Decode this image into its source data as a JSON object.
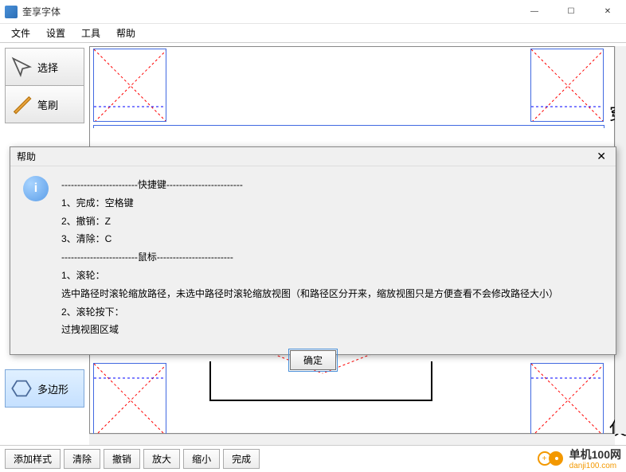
{
  "window": {
    "title": "奎享字体",
    "min": "—",
    "max": "☐",
    "close": "✕"
  },
  "menu": {
    "file": "文件",
    "settings": "设置",
    "tools": "工具",
    "help": "帮助"
  },
  "tools": {
    "select": "选择",
    "brush": "笔刷",
    "polygon": "多边形"
  },
  "chars": {
    "c1": "穿",
    "c2": "仗"
  },
  "bottom": {
    "addStyle": "添加样式",
    "clear": "清除",
    "undo": "撤销",
    "zoomIn": "放大",
    "zoomOut": "缩小",
    "finish": "完成"
  },
  "dialog": {
    "title": "帮助",
    "section1_div": "------------------------快捷键------------------------",
    "line1": "1、完成：空格键",
    "line2": "2、撤销：Z",
    "line3": "3、清除：C",
    "section2_div": "------------------------鼠标------------------------",
    "line4": "1、滚轮：",
    "line5": "选中路径时滚轮缩放路径，未选中路径时滚轮缩放视图（和路径区分开来，缩放视图只是方便查看不会修改路径大小）",
    "line6": "2、滚轮按下：",
    "line7": "过拽视图区域",
    "ok": "确定",
    "icon": "i"
  },
  "watermark": {
    "name": "单机100网",
    "url": "danji100.com"
  }
}
